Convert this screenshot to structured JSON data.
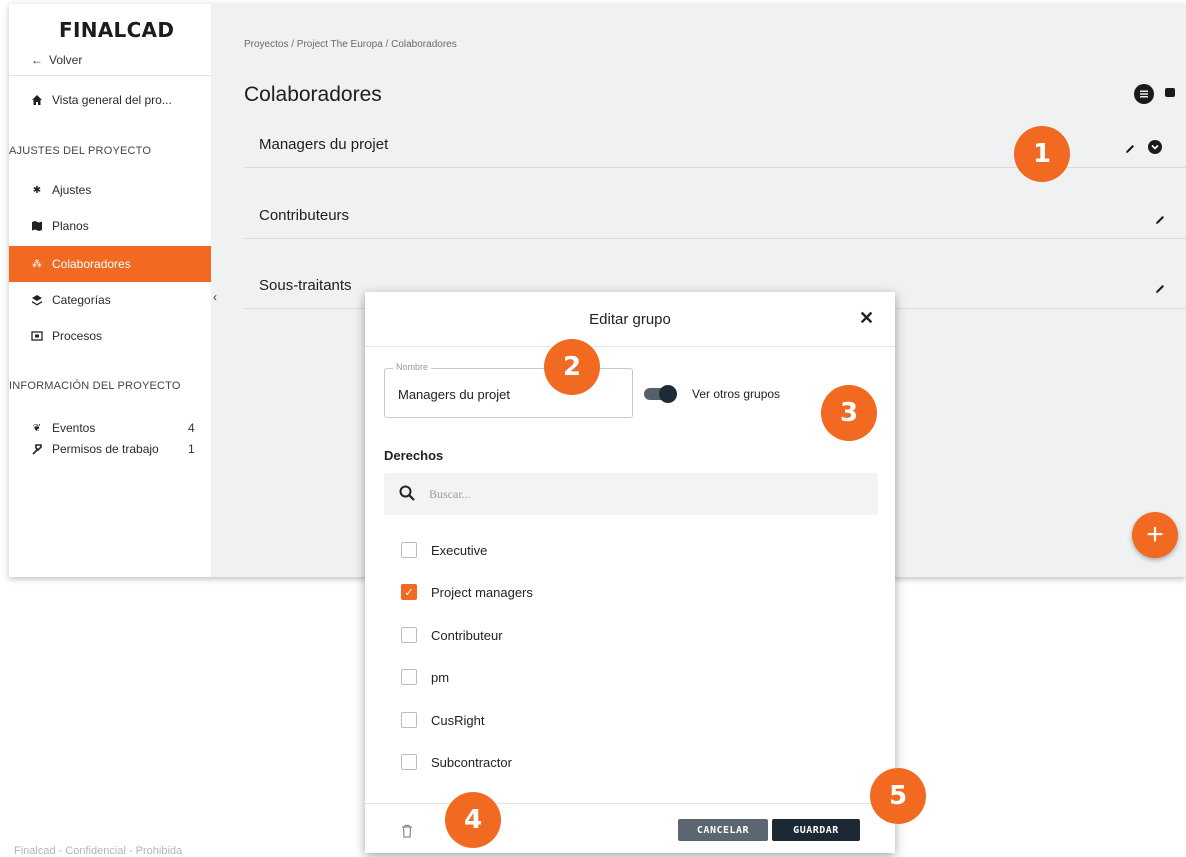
{
  "sidebar": {
    "logo": "FINALCAD",
    "back_label": "Volver",
    "overview_label": "Vista general del pro...",
    "settings_section": "AJUSTES DEL PROYECTO",
    "settings_items": [
      {
        "label": "Ajustes",
        "icon": "gear-icon"
      },
      {
        "label": "Planos",
        "icon": "map-icon"
      },
      {
        "label": "Colaboradores",
        "icon": "people-icon",
        "active": true
      },
      {
        "label": "Categorías",
        "icon": "layers-icon"
      },
      {
        "label": "Procesos",
        "icon": "process-icon"
      }
    ],
    "info_section": "INFORMACIÓN DEL PROYECTO",
    "info_items": [
      {
        "label": "Eventos",
        "count": "4",
        "icon": "events-icon"
      },
      {
        "label": "Permisos de trabajo",
        "count": "1",
        "icon": "hammer-icon"
      }
    ]
  },
  "main": {
    "breadcrumb": "Proyectos / Project The Europa / Colaboradores",
    "title": "Colaboradores",
    "groups": [
      {
        "name": "Managers du projet"
      },
      {
        "name": "Contributeurs"
      },
      {
        "name": "Sous-traitants"
      }
    ]
  },
  "dialog": {
    "title": "Editar grupo",
    "name_legend": "Nombre",
    "name_value": "Managers du projet",
    "toggle_label": "Ver otros grupos",
    "rights_label": "Derechos",
    "search_placeholder": "Buscar...",
    "rights": [
      {
        "label": "Executive",
        "checked": false
      },
      {
        "label": "Project managers",
        "checked": true
      },
      {
        "label": "Contributeur",
        "checked": false
      },
      {
        "label": "pm",
        "checked": false
      },
      {
        "label": "CusRight",
        "checked": false
      },
      {
        "label": "Subcontractor",
        "checked": false
      }
    ],
    "cancel_label": "CANCELAR",
    "save_label": "GUARDAR"
  },
  "badges": [
    "1",
    "2",
    "3",
    "4",
    "5"
  ],
  "footer": "Finalcad - Confidencial - Prohibida",
  "colors": {
    "accent": "#f26a21",
    "dark": "#1c2834"
  }
}
